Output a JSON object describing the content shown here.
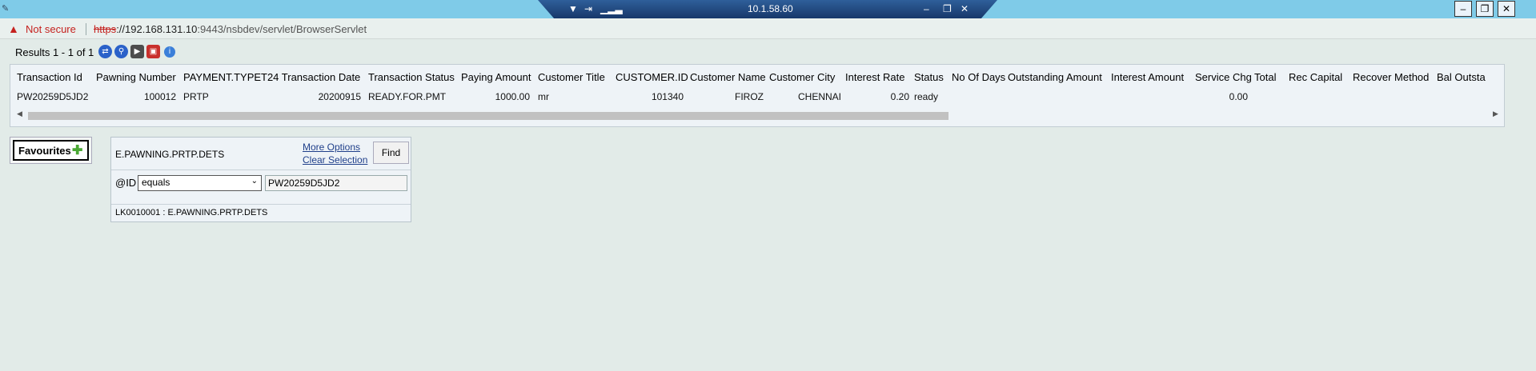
{
  "session": {
    "host": "10.1.58.60",
    "minimize_icon": "minimize-icon",
    "restore_icon": "restore-icon",
    "close_icon": "close-icon"
  },
  "address": {
    "security_label": "Not secure",
    "url_scheme": "https",
    "url_host": "://192.168.131.10",
    "url_rest": ":9443/nsbdev/servlet/BrowserServlet"
  },
  "results": {
    "summary": "Results 1 - 1 of 1"
  },
  "table": {
    "columns": [
      "Transaction Id",
      "Pawning Number",
      "PAYMENT.TYPE",
      "T24 Transaction Date",
      "Transaction Status",
      "Paying Amount",
      "Customer Title",
      "CUSTOMER.ID",
      "Customer Name",
      "Customer City",
      "Interest Rate",
      "Status",
      "No Of Days",
      "Outstanding Amount",
      "Interest Amount",
      "Service Chg",
      "Total",
      "Rec Capital",
      "Recover Method",
      "Bal Outsta"
    ],
    "row": [
      "PW20259D5JD2",
      "100012",
      "PRTP",
      "20200915",
      "READY.FOR.PMT",
      "1000.00",
      "mr",
      "101340",
      "FIROZ",
      "CHENNAI",
      "0.20",
      "ready",
      "",
      "",
      "",
      "0.00",
      "",
      "",
      "",
      ""
    ]
  },
  "favourites": {
    "label": "Favourites"
  },
  "enquiry": {
    "name": "E.PAWNING.PRTP.DETS",
    "more_options": "More Options",
    "clear_selection": "Clear Selection",
    "find": "Find",
    "field_label": "@ID",
    "operand": "equals",
    "value": "PW20259D5JD2",
    "footer": "LK0010001 : E.PAWNING.PRTP.DETS"
  },
  "colors": {
    "strip": "#7fcbe8",
    "page_bg": "#e2ebe8",
    "warning": "#c5221f",
    "link": "#1f3f8a"
  }
}
